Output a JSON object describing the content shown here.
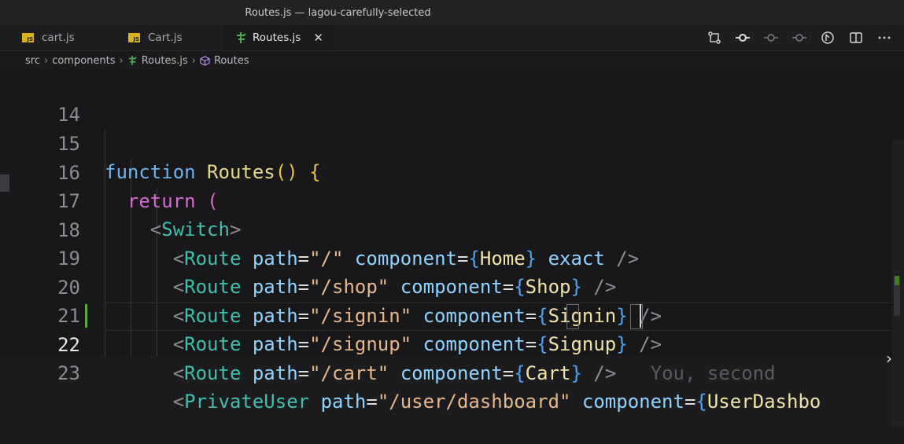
{
  "window": {
    "title": "Routes.js — lagou-carefully-selected"
  },
  "tabs": [
    {
      "label": "cart.js",
      "icon": "js-file-icon",
      "active": false
    },
    {
      "label": "Cart.js",
      "icon": "js-file-icon",
      "active": false
    },
    {
      "label": "Routes.js",
      "icon": "route-file-icon",
      "active": true
    }
  ],
  "toolbar": {
    "icons": [
      "source-control-compare-icon",
      "git-commit-icon",
      "git-commit-prev-icon",
      "git-commit-next-icon",
      "open-changes-icon",
      "split-editor-icon",
      "more-actions-icon"
    ]
  },
  "breadcrumb": {
    "items": [
      "src",
      "components",
      "Routes.js",
      "Routes"
    ]
  },
  "editor": {
    "current_line": 22,
    "lines": [
      {
        "num": "14",
        "text": ""
      },
      {
        "num": "15",
        "text": "function Routes() {"
      },
      {
        "num": "16",
        "text": "  return ("
      },
      {
        "num": "17",
        "text": "    <Switch>"
      },
      {
        "num": "18",
        "text": "      <Route path=\"/\" component={Home} exact />"
      },
      {
        "num": "19",
        "text": "      <Route path=\"/shop\" component={Shop} />"
      },
      {
        "num": "20",
        "text": "      <Route path=\"/signin\" component={Signin} />"
      },
      {
        "num": "21",
        "text": "      <Route path=\"/signup\" component={Signup} />"
      },
      {
        "num": "22",
        "text": "      <Route path=\"/cart\" component={Cart} />"
      },
      {
        "num": "23",
        "text": "      <PrivateUser path=\"/user/dashboard\" component={UserDashbo"
      }
    ],
    "inline_blame": "You, second"
  },
  "colors": {
    "accent_modified": "#5cae3b",
    "keyword": "#6fb3f2",
    "tag": "#3fbfae"
  }
}
